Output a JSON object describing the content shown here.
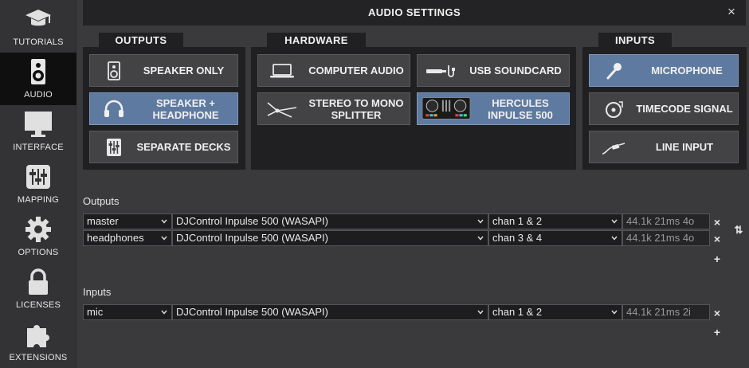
{
  "sidebar": {
    "items": [
      {
        "label": "TUTORIALS",
        "icon": "graduation-cap-icon"
      },
      {
        "label": "AUDIO",
        "icon": "speaker-icon"
      },
      {
        "label": "INTERFACE",
        "icon": "monitor-icon"
      },
      {
        "label": "MAPPING",
        "icon": "sliders-icon"
      },
      {
        "label": "OPTIONS",
        "icon": "gear-icon"
      },
      {
        "label": "LICENSES",
        "icon": "lock-icon"
      },
      {
        "label": "EXTENSIONS",
        "icon": "puzzle-icon"
      }
    ],
    "active": "AUDIO"
  },
  "window": {
    "title": "AUDIO SETTINGS",
    "close": "×"
  },
  "outputs_panel": {
    "tab": "OUTPUTS",
    "buttons": [
      {
        "label": "SPEAKER ONLY",
        "icon": "speaker-icon",
        "selected": false
      },
      {
        "label": "SPEAKER + HEADPHONE",
        "icon": "headphones-icon",
        "selected": true
      },
      {
        "label": "SEPARATE DECKS",
        "icon": "mixer-icon",
        "selected": false
      }
    ]
  },
  "hardware_panel": {
    "tab": "HARDWARE",
    "buttons": [
      {
        "label": "COMPUTER AUDIO",
        "icon": "laptop-icon",
        "selected": false
      },
      {
        "label": "USB SOUNDCARD",
        "icon": "usb-soundcard-icon",
        "selected": false
      },
      {
        "label": "STEREO TO MONO SPLITTER",
        "icon": "splitter-cable-icon",
        "selected": false
      },
      {
        "label": "HERCULES INPULSE 500",
        "icon": "dj-controller-icon",
        "selected": true
      }
    ]
  },
  "inputs_panel": {
    "tab": "INPUTS",
    "buttons": [
      {
        "label": "MICROPHONE",
        "icon": "microphone-icon",
        "selected": true
      },
      {
        "label": "TIMECODE SIGNAL",
        "icon": "turntable-icon",
        "selected": false
      },
      {
        "label": "LINE INPUT",
        "icon": "jack-cable-icon",
        "selected": false
      }
    ]
  },
  "outputs_section": {
    "label": "Outputs",
    "rows": [
      {
        "name": "master",
        "device": "DJControl Inpulse 500 (WASAPI)",
        "channels": "chan 1 & 2",
        "info": "44.1k 21ms 4o"
      },
      {
        "name": "headphones",
        "device": "DJControl Inpulse 500 (WASAPI)",
        "channels": "chan 3 & 4",
        "info": "44.1k 21ms 4o"
      }
    ],
    "remove": "×",
    "add": "+",
    "swap": "⇅"
  },
  "inputs_section": {
    "label": "Inputs",
    "rows": [
      {
        "name": "mic",
        "device": "DJControl Inpulse 500 (WASAPI)",
        "channels": "chan 1 & 2",
        "info": "44.1k 21ms 2i"
      }
    ],
    "remove": "×",
    "add": "+"
  },
  "colors": {
    "selected_button": "#5f7aa0",
    "panel_bg": "#202022",
    "page_bg": "#3a3a3c",
    "sidebar_active": "#0f0f10"
  }
}
